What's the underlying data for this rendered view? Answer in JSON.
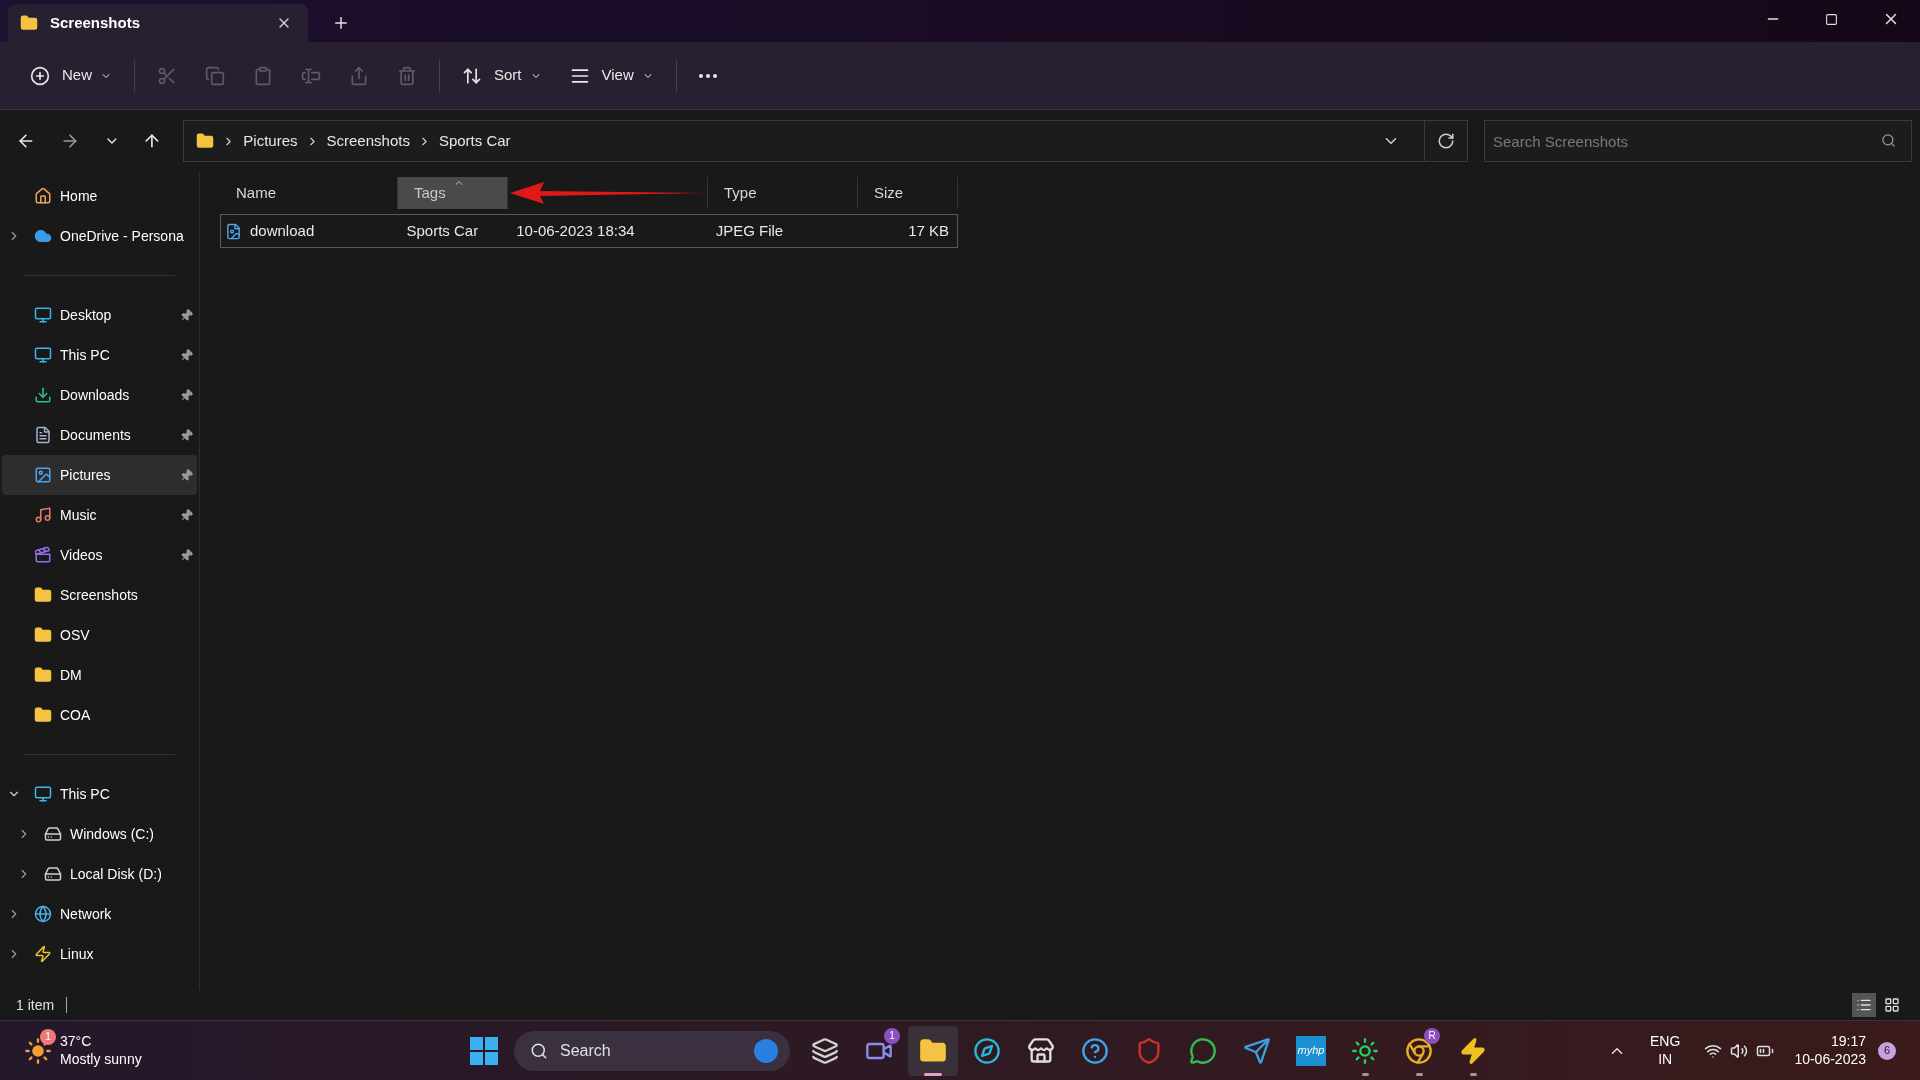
{
  "window": {
    "tab_title": "Screenshots"
  },
  "toolbar": [
    {
      "kind": "menu",
      "label": "New",
      "disabled": false
    },
    {
      "kind": "icon",
      "disabled": true
    },
    {
      "kind": "icon",
      "disabled": true
    },
    {
      "kind": "icon",
      "disabled": true
    },
    {
      "kind": "icon",
      "disabled": true
    },
    {
      "kind": "icon",
      "disabled": true
    },
    {
      "kind": "icon",
      "disabled": true
    },
    {
      "kind": "menu",
      "label": "Sort",
      "disabled": false
    },
    {
      "kind": "menu",
      "label": "View",
      "disabled": false
    },
    {
      "kind": "icon",
      "disabled": false
    }
  ],
  "breadcrumb": [
    "Pictures",
    "Screenshots",
    "Sports Car"
  ],
  "search": {
    "placeholder": "Search Screenshots"
  },
  "sidebar": {
    "sections": [
      [
        {
          "label": "Home",
          "kind": "link",
          "expanded": false,
          "pinned": false,
          "selected": false
        },
        {
          "label": "OneDrive - Persona",
          "kind": "branch",
          "expanded": false,
          "pinned": false,
          "selected": false
        }
      ],
      [
        {
          "label": "Desktop",
          "kind": "link",
          "expanded": false,
          "pinned": true,
          "selected": false
        },
        {
          "label": "This PC",
          "kind": "link",
          "expanded": false,
          "pinned": true,
          "selected": false
        },
        {
          "label": "Downloads",
          "kind": "link",
          "expanded": false,
          "pinned": true,
          "selected": false
        },
        {
          "label": "Documents",
          "kind": "link",
          "expanded": false,
          "pinned": true,
          "selected": false
        },
        {
          "label": "Pictures",
          "kind": "link",
          "expanded": false,
          "pinned": true,
          "selected": true
        },
        {
          "label": "Music",
          "kind": "link",
          "expanded": false,
          "pinned": true,
          "selected": false
        },
        {
          "label": "Videos",
          "kind": "link",
          "expanded": false,
          "pinned": true,
          "selected": false
        },
        {
          "label": "Screenshots",
          "kind": "link",
          "expanded": false,
          "pinned": false,
          "selected": false
        },
        {
          "label": "OSV",
          "kind": "link",
          "expanded": false,
          "pinned": false,
          "selected": false
        },
        {
          "label": "DM",
          "kind": "link",
          "expanded": false,
          "pinned": false,
          "selected": false
        },
        {
          "label": "COA",
          "kind": "link",
          "expanded": false,
          "pinned": false,
          "selected": false
        }
      ],
      [
        {
          "label": "This PC",
          "kind": "branch",
          "expanded": true,
          "pinned": false,
          "selected": false,
          "children": [
            {
              "label": "Windows (C:)",
              "kind": "branch",
              "expanded": false,
              "pinned": false,
              "selected": false
            },
            {
              "label": "Local Disk (D:)",
              "kind": "branch",
              "expanded": false,
              "pinned": false,
              "selected": false
            }
          ]
        },
        {
          "label": "Network",
          "kind": "branch",
          "expanded": false,
          "pinned": false,
          "selected": false
        },
        {
          "label": "Linux",
          "kind": "branch",
          "expanded": false,
          "pinned": false,
          "selected": false
        }
      ]
    ]
  },
  "table": {
    "columns": [
      {
        "label": "Name",
        "selected": false
      },
      {
        "label": "Tags",
        "selected": true
      },
      {
        "selected": false
      },
      {
        "label": "Type",
        "selected": false
      },
      {
        "label": "Size",
        "selected": false
      }
    ],
    "rows": [
      {
        "selected": true,
        "cells": [
          "download",
          "Sports Car",
          "10-06-2023 18:34",
          "JPEG File",
          "17 KB"
        ]
      }
    ]
  },
  "status_bar": {
    "count": "1 item",
    "views": [
      {
        "selected": true
      },
      {
        "selected": false
      }
    ]
  },
  "taskbar": {
    "weather": {
      "badge": "1",
      "temperature": "37°C",
      "condition": "Mostly sunny"
    },
    "search": {
      "placeholder": "Search"
    },
    "apps": [
      {
        "running": false,
        "active": false
      },
      {
        "badge": "1",
        "running": false,
        "active": false
      },
      {
        "running": true,
        "active": true
      },
      {
        "running": false,
        "active": false
      },
      {
        "running": false,
        "active": false
      },
      {
        "running": false,
        "active": false
      },
      {
        "running": false,
        "active": false
      },
      {
        "running": false,
        "active": false
      },
      {
        "running": false,
        "active": false
      },
      {
        "label": "myhp",
        "running": false,
        "active": false
      },
      {
        "running": true,
        "active": false
      },
      {
        "badge": "R",
        "running": true,
        "active": false
      },
      {
        "running": true,
        "active": false
      }
    ],
    "language": [
      "ENG",
      "IN"
    ],
    "time": "19:17",
    "date": "10-06-2023",
    "notifications": "6"
  }
}
